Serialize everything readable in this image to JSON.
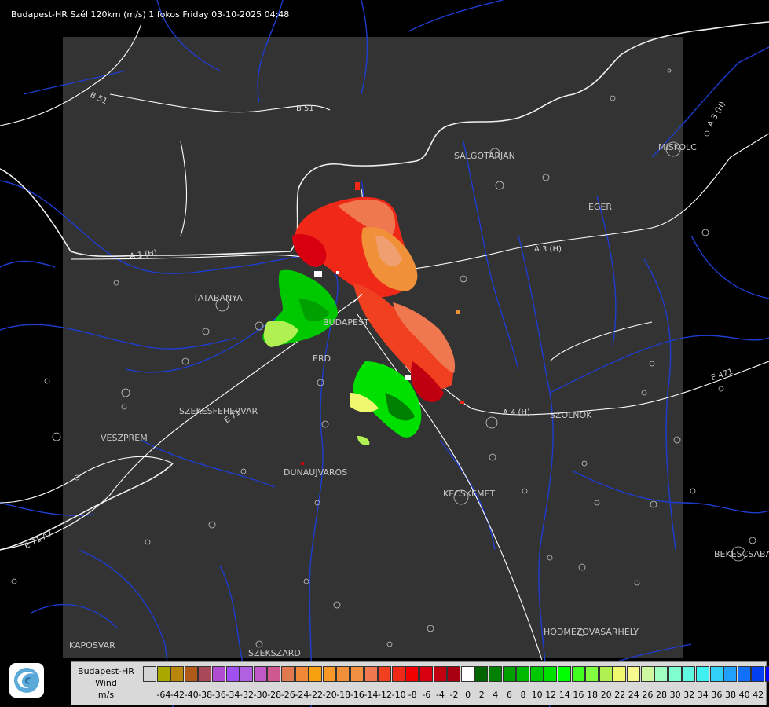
{
  "title": "Budapest-HR Szél 120km (m/s) 1 fokos Friday 03-10-2025 04:48",
  "cities": {
    "salgotarjan": "SALGOTARJAN",
    "miskolc": "MISKOLC",
    "eger": "EGER",
    "tatabanya": "TATABANYA",
    "budapest": "BUDAPEST",
    "erd": "ERD",
    "szekesfehervar": "SZEKESFEHERVAR",
    "veszprem": "VESZPREM",
    "szolnok": "SZOLNOK",
    "dunaujvaros": "DUNAUJVAROS",
    "kecskemet": "KECSKEMET",
    "bekescsaba": "BEKESCSABA",
    "hodmezovasarhely": "HODMEZOVASARHELY",
    "kaposvar": "KAPOSVAR",
    "szekszard": "SZEKSZARD"
  },
  "roads": {
    "b51_left": "B 51",
    "b51_right": "B 51",
    "a3_mid": "A 3 (H)",
    "a3_ne": "A 3 (H)",
    "a1": "A 1 (H)",
    "a4": "A 4 (H)",
    "e71": "E 71",
    "e71_sw": "E 71 A7",
    "e47": "E 471"
  },
  "legend": {
    "line1": "Budapest-HR",
    "line2": "Wind",
    "line3": "m/s",
    "ticks": [
      "-64",
      "-42",
      "-40",
      "-38",
      "-36",
      "-34",
      "-32",
      "-30",
      "-28",
      "-26",
      "-24",
      "-22",
      "-20",
      "-18",
      "-16",
      "-14",
      "-12",
      "-10",
      "-8",
      "-6",
      "-4",
      "-2",
      "0",
      "2",
      "4",
      "6",
      "8",
      "10",
      "12",
      "14",
      "16",
      "18",
      "20",
      "22",
      "24",
      "26",
      "28",
      "30",
      "32",
      "34",
      "36",
      "38",
      "40",
      "42"
    ],
    "colors": [
      "#d4d4d4",
      "#a8a800",
      "#b8860b",
      "#b05a1a",
      "#a84858",
      "#b04cd0",
      "#a050f0",
      "#b060e0",
      "#c058c8",
      "#d05890",
      "#e07850",
      "#f08838",
      "#f8a010",
      "#f89828",
      "#f09038",
      "#f09040",
      "#f07850",
      "#f04020",
      "#f02818",
      "#f00000",
      "#d80010",
      "#c00010",
      "#a80010",
      "#ffffff",
      "#006400",
      "#008000",
      "#00a000",
      "#00b800",
      "#00c800",
      "#00e000",
      "#00ff00",
      "#40ff20",
      "#80ff40",
      "#b0f050",
      "#f0f870",
      "#f8f890",
      "#d0f8a0",
      "#a0ffc0",
      "#80ffd0",
      "#60f8e0",
      "#40f0f0",
      "#30d0f8",
      "#20a0f8",
      "#1070f8",
      "#0040f0",
      "#0000f8"
    ]
  },
  "colors": {
    "map_panel": "#333333",
    "river": "#1e3dd0",
    "border": "#e8e8e8",
    "contour": "#c8c8c8"
  }
}
